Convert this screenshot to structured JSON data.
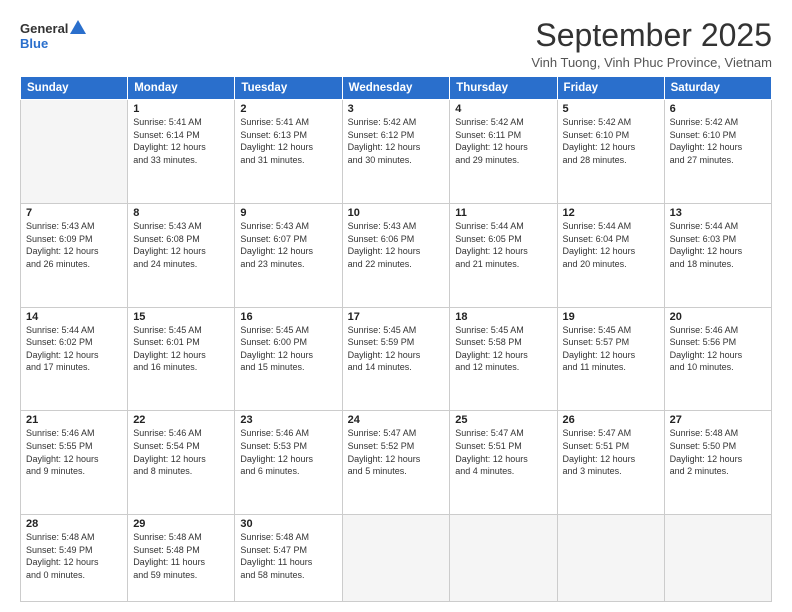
{
  "logo": {
    "line1": "General",
    "line2": "Blue"
  },
  "title": "September 2025",
  "subtitle": "Vinh Tuong, Vinh Phuc Province, Vietnam",
  "headers": [
    "Sunday",
    "Monday",
    "Tuesday",
    "Wednesday",
    "Thursday",
    "Friday",
    "Saturday"
  ],
  "weeks": [
    [
      {
        "day": "",
        "info": ""
      },
      {
        "day": "1",
        "info": "Sunrise: 5:41 AM\nSunset: 6:14 PM\nDaylight: 12 hours\nand 33 minutes."
      },
      {
        "day": "2",
        "info": "Sunrise: 5:41 AM\nSunset: 6:13 PM\nDaylight: 12 hours\nand 31 minutes."
      },
      {
        "day": "3",
        "info": "Sunrise: 5:42 AM\nSunset: 6:12 PM\nDaylight: 12 hours\nand 30 minutes."
      },
      {
        "day": "4",
        "info": "Sunrise: 5:42 AM\nSunset: 6:11 PM\nDaylight: 12 hours\nand 29 minutes."
      },
      {
        "day": "5",
        "info": "Sunrise: 5:42 AM\nSunset: 6:10 PM\nDaylight: 12 hours\nand 28 minutes."
      },
      {
        "day": "6",
        "info": "Sunrise: 5:42 AM\nSunset: 6:10 PM\nDaylight: 12 hours\nand 27 minutes."
      }
    ],
    [
      {
        "day": "7",
        "info": "Sunrise: 5:43 AM\nSunset: 6:09 PM\nDaylight: 12 hours\nand 26 minutes."
      },
      {
        "day": "8",
        "info": "Sunrise: 5:43 AM\nSunset: 6:08 PM\nDaylight: 12 hours\nand 24 minutes."
      },
      {
        "day": "9",
        "info": "Sunrise: 5:43 AM\nSunset: 6:07 PM\nDaylight: 12 hours\nand 23 minutes."
      },
      {
        "day": "10",
        "info": "Sunrise: 5:43 AM\nSunset: 6:06 PM\nDaylight: 12 hours\nand 22 minutes."
      },
      {
        "day": "11",
        "info": "Sunrise: 5:44 AM\nSunset: 6:05 PM\nDaylight: 12 hours\nand 21 minutes."
      },
      {
        "day": "12",
        "info": "Sunrise: 5:44 AM\nSunset: 6:04 PM\nDaylight: 12 hours\nand 20 minutes."
      },
      {
        "day": "13",
        "info": "Sunrise: 5:44 AM\nSunset: 6:03 PM\nDaylight: 12 hours\nand 18 minutes."
      }
    ],
    [
      {
        "day": "14",
        "info": "Sunrise: 5:44 AM\nSunset: 6:02 PM\nDaylight: 12 hours\nand 17 minutes."
      },
      {
        "day": "15",
        "info": "Sunrise: 5:45 AM\nSunset: 6:01 PM\nDaylight: 12 hours\nand 16 minutes."
      },
      {
        "day": "16",
        "info": "Sunrise: 5:45 AM\nSunset: 6:00 PM\nDaylight: 12 hours\nand 15 minutes."
      },
      {
        "day": "17",
        "info": "Sunrise: 5:45 AM\nSunset: 5:59 PM\nDaylight: 12 hours\nand 14 minutes."
      },
      {
        "day": "18",
        "info": "Sunrise: 5:45 AM\nSunset: 5:58 PM\nDaylight: 12 hours\nand 12 minutes."
      },
      {
        "day": "19",
        "info": "Sunrise: 5:45 AM\nSunset: 5:57 PM\nDaylight: 12 hours\nand 11 minutes."
      },
      {
        "day": "20",
        "info": "Sunrise: 5:46 AM\nSunset: 5:56 PM\nDaylight: 12 hours\nand 10 minutes."
      }
    ],
    [
      {
        "day": "21",
        "info": "Sunrise: 5:46 AM\nSunset: 5:55 PM\nDaylight: 12 hours\nand 9 minutes."
      },
      {
        "day": "22",
        "info": "Sunrise: 5:46 AM\nSunset: 5:54 PM\nDaylight: 12 hours\nand 8 minutes."
      },
      {
        "day": "23",
        "info": "Sunrise: 5:46 AM\nSunset: 5:53 PM\nDaylight: 12 hours\nand 6 minutes."
      },
      {
        "day": "24",
        "info": "Sunrise: 5:47 AM\nSunset: 5:52 PM\nDaylight: 12 hours\nand 5 minutes."
      },
      {
        "day": "25",
        "info": "Sunrise: 5:47 AM\nSunset: 5:51 PM\nDaylight: 12 hours\nand 4 minutes."
      },
      {
        "day": "26",
        "info": "Sunrise: 5:47 AM\nSunset: 5:51 PM\nDaylight: 12 hours\nand 3 minutes."
      },
      {
        "day": "27",
        "info": "Sunrise: 5:48 AM\nSunset: 5:50 PM\nDaylight: 12 hours\nand 2 minutes."
      }
    ],
    [
      {
        "day": "28",
        "info": "Sunrise: 5:48 AM\nSunset: 5:49 PM\nDaylight: 12 hours\nand 0 minutes."
      },
      {
        "day": "29",
        "info": "Sunrise: 5:48 AM\nSunset: 5:48 PM\nDaylight: 11 hours\nand 59 minutes."
      },
      {
        "day": "30",
        "info": "Sunrise: 5:48 AM\nSunset: 5:47 PM\nDaylight: 11 hours\nand 58 minutes."
      },
      {
        "day": "",
        "info": ""
      },
      {
        "day": "",
        "info": ""
      },
      {
        "day": "",
        "info": ""
      },
      {
        "day": "",
        "info": ""
      }
    ]
  ]
}
